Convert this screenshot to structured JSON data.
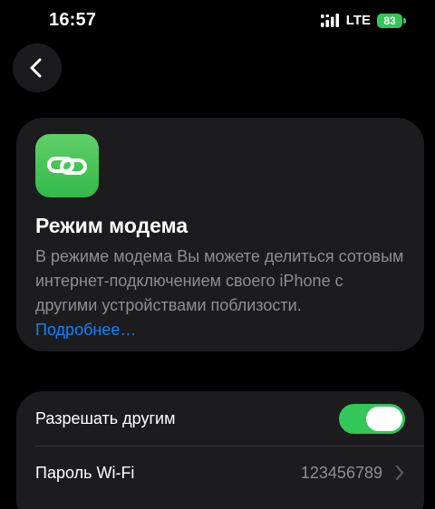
{
  "status_bar": {
    "time": "16:57",
    "network": "LTE",
    "battery": "83"
  },
  "nav": {
    "back_icon": "chevron-left-icon"
  },
  "hotspot_card": {
    "icon": "link-chain-icon",
    "title": "Режим модема",
    "description": "В режиме модема Вы можете делиться сотовым интернет-подключением своего iPhone с другими устройствами поблизости.",
    "link": "Подробнее…"
  },
  "settings": {
    "allow_others": {
      "label": "Разрешать другим",
      "enabled": true
    },
    "wifi_password": {
      "label": "Пароль Wi-Fi",
      "value": "123456789"
    }
  },
  "colors": {
    "accent_green": "#32c759",
    "link_blue": "#0a84ff",
    "card_background": "#1c1c1e",
    "secondary_text": "#8e8e93"
  }
}
